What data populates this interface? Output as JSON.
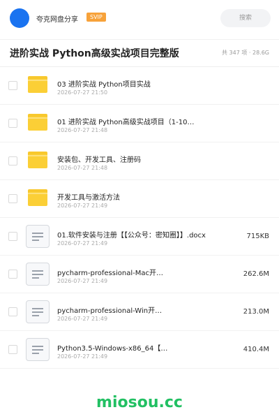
{
  "header": {
    "brand": "夸克网盘分享",
    "badge": "SVIP",
    "search_label": "搜索"
  },
  "title": "进阶实战 Python高级实战项目完整版",
  "meta": "共 347 项 · 28.6G",
  "items": [
    {
      "type": "folder",
      "name": "03 进阶实战 Python项目实战",
      "date": "2026-07-27 21:50",
      "size": ""
    },
    {
      "type": "folder",
      "name": "01 进阶实战 Python高级实战项目（1-10…",
      "date": "2026-07-27 21:48",
      "size": ""
    },
    {
      "type": "folder",
      "name": "安装包、开发工具、注册码",
      "date": "2026-07-27 21:48",
      "size": ""
    },
    {
      "type": "folder",
      "name": "开发工具与激活方法",
      "date": "2026-07-27 21:49",
      "size": ""
    },
    {
      "type": "file",
      "name": "01.软件安装与注册【【公众号：密知圈】】.docx",
      "date": "2026-07-27 21:49",
      "size": "715KB"
    },
    {
      "type": "file",
      "name": "pycharm-professional-Mac开…",
      "date": "2026-07-27 21:49",
      "size": "262.6M"
    },
    {
      "type": "file",
      "name": "pycharm-professional-Win开…",
      "date": "2026-07-27 21:49",
      "size": "213.0M"
    },
    {
      "type": "file",
      "name": "Python3.5-Windows-x86_64【…",
      "date": "2026-07-27 21:49",
      "size": "410.4M"
    }
  ],
  "watermark": "miosou.cc",
  "colors": {
    "accent": "#1a73f0",
    "badge": "#f7a23a",
    "folder": "#fbcf36",
    "watermark": "#22c063"
  }
}
